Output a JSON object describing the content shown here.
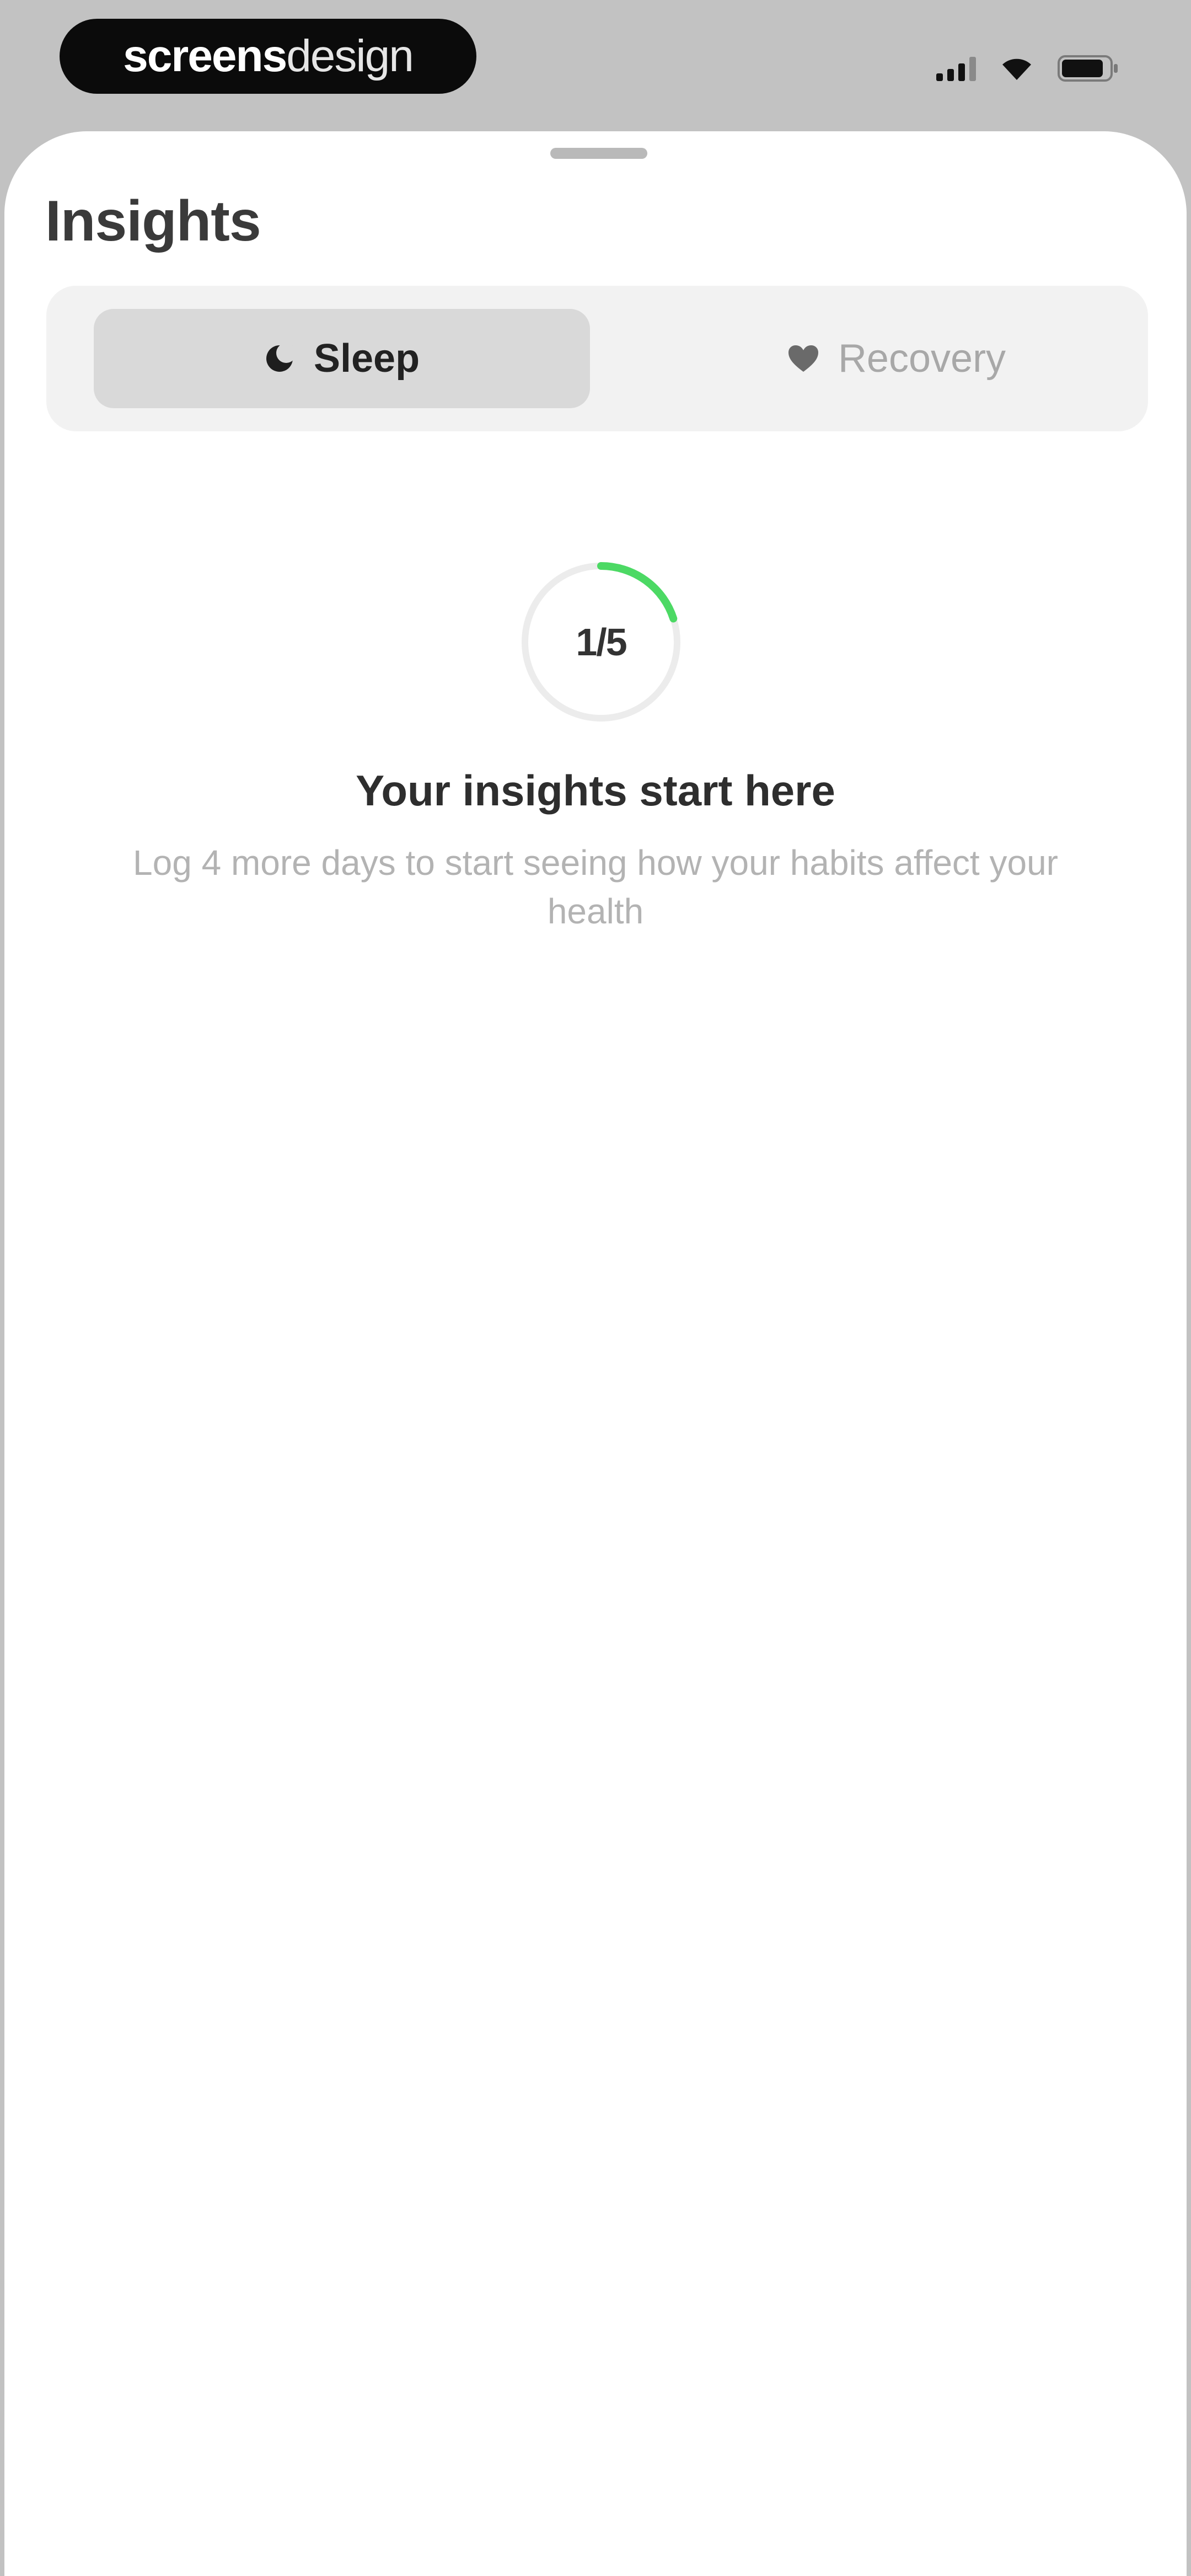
{
  "status_bar": {
    "brand_bold": "screens",
    "brand_light": "design",
    "icons": [
      "signal-icon",
      "wifi-icon",
      "battery-icon"
    ]
  },
  "header": {
    "title": "Insights"
  },
  "tabs": [
    {
      "label": "Sleep",
      "icon": "moon-icon",
      "selected": true
    },
    {
      "label": "Recovery",
      "icon": "heart-icon",
      "selected": false
    }
  ],
  "progress": {
    "label": "1/5",
    "current": 1,
    "total": 5,
    "accent_color": "#4cd964",
    "track_color": "#ececec"
  },
  "empty_state": {
    "title": "Your insights start here",
    "subtitle": "Log 4 more days to start seeing how your habits affect your health"
  },
  "colors": {
    "sheet_background": "#ffffff",
    "backdrop": "#c2c2c2",
    "accent": "#4cd964"
  }
}
